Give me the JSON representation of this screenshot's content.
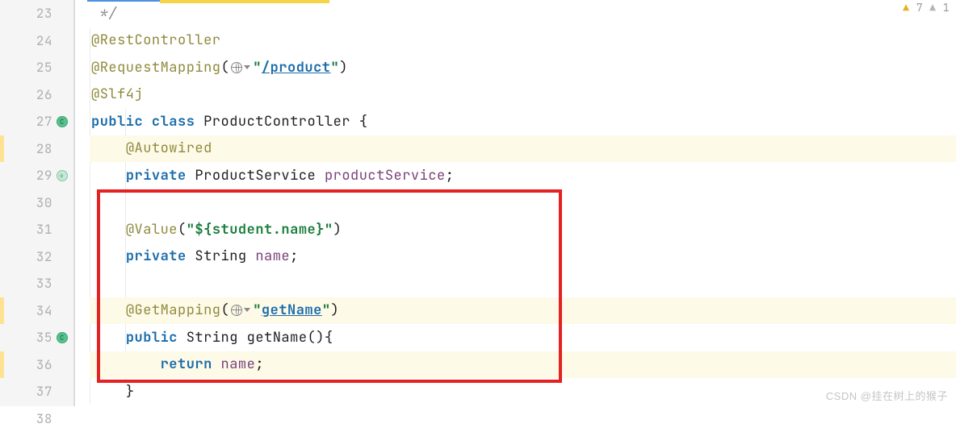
{
  "lineNumbers": [
    "23",
    "24",
    "25",
    "26",
    "27",
    "28",
    "29",
    "30",
    "31",
    "32",
    "33",
    "34",
    "35",
    "36",
    "37",
    "38"
  ],
  "warnings": {
    "yellow": "7",
    "gray": "1"
  },
  "watermark": "CSDN @挂在树上的猴子",
  "code": {
    "l23_comment": " */",
    "l24_ann": "@RestController",
    "l25_ann": "@RequestMapping",
    "l25_paren_open": "(",
    "l25_str_open": "\"",
    "l25_url": "/product",
    "l25_str_close": "\"",
    "l25_paren_close": ")",
    "l26_ann": "@Slf4j",
    "l27_public": "public",
    "l27_class": "class",
    "l27_name": "ProductController",
    "l27_brace": " {",
    "l28_ann": "@Autowired",
    "l29_private": "private",
    "l29_type": "ProductService",
    "l29_field": "productService",
    "l29_semi": ";",
    "l31_ann": "@Value",
    "l31_paren_open": "(",
    "l31_str": "\"${student.name}\"",
    "l31_paren_close": ")",
    "l32_private": "private",
    "l32_type": "String",
    "l32_field": "name",
    "l32_semi": ";",
    "l34_ann": "@GetMapping",
    "l34_paren_open": "(",
    "l34_str_open": "\"",
    "l34_url": "getName",
    "l34_str_close": "\"",
    "l34_paren_close": ")",
    "l35_public": "public",
    "l35_type": "String",
    "l35_method": "getName",
    "l35_sig": "(){",
    "l36_return": "return",
    "l36_field": "name",
    "l36_semi": ";",
    "l37_brace": "}"
  }
}
